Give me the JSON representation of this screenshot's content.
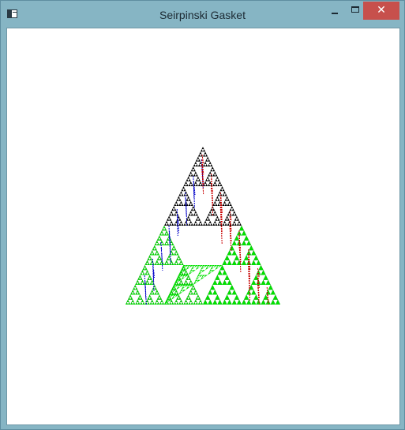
{
  "window": {
    "title": "Seirpinski Gasket",
    "icon": "application-icon",
    "controls": {
      "minimize_glyph": "",
      "maximize_glyph": "",
      "close_glyph": "✕"
    }
  },
  "canvas": {
    "background": "#ffffff",
    "fractal": {
      "name": "Sierpinski gasket",
      "colors": {
        "black": "#000000",
        "blue": "#0000c8",
        "red": "#c80000",
        "green": "#00e000"
      }
    }
  },
  "colors": {
    "frame": "#86b5c4",
    "close_button": "#c7504c"
  }
}
